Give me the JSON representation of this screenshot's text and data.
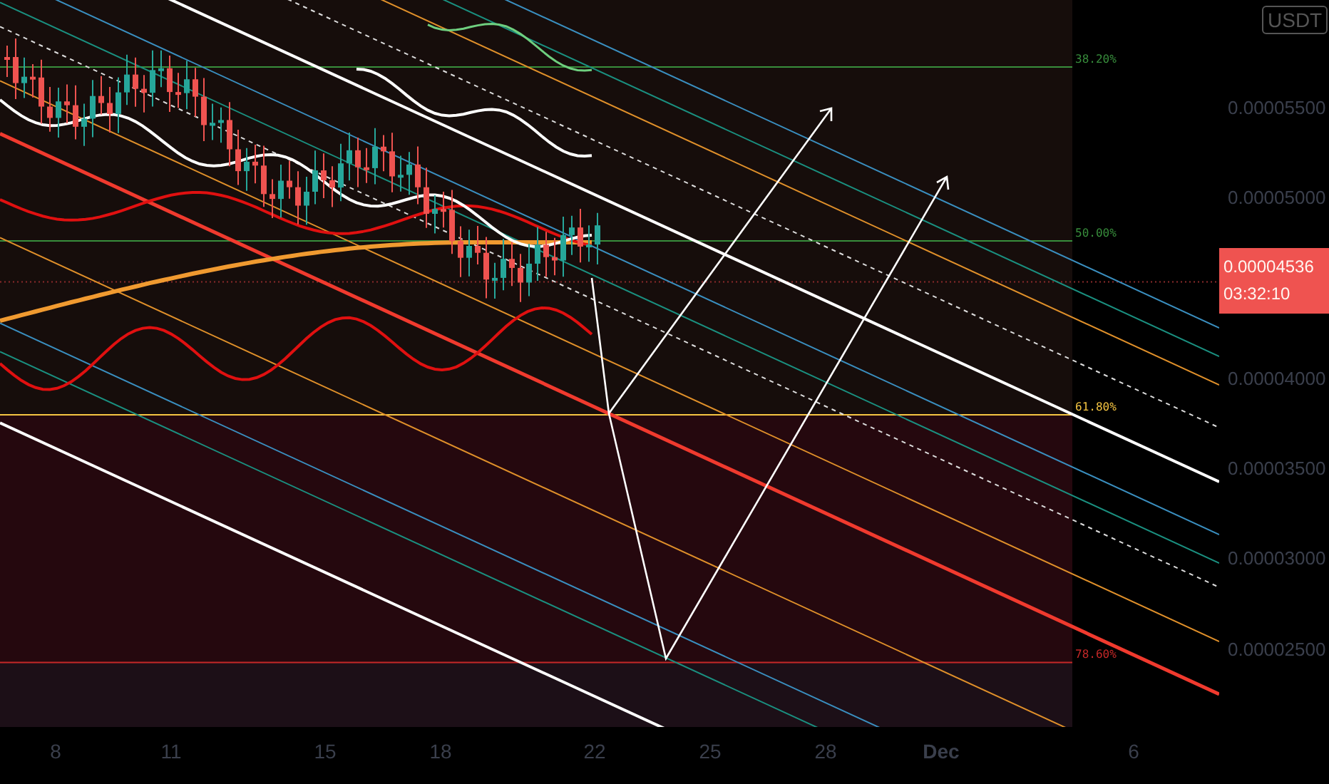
{
  "chart": {
    "fib_levels": [
      {
        "label": "38.20%",
        "color": "#388e3c"
      },
      {
        "label": "50.00%",
        "color": "#388e3c"
      },
      {
        "label": "61.80%",
        "color": "#f5c542"
      },
      {
        "label": "78.60%",
        "color": "#c62828"
      }
    ]
  },
  "price_axis": {
    "currency_button": "USDT",
    "labels": [
      "0.00005500",
      "0.00005000",
      "0.00004000",
      "0.00003500",
      "0.00003000",
      "0.00002500"
    ]
  },
  "last_price": {
    "price": "0.00004536",
    "countdown": "03:32:10"
  },
  "time_axis": [
    {
      "label": "8",
      "kind": "day"
    },
    {
      "label": "11",
      "kind": "day"
    },
    {
      "label": "15",
      "kind": "day"
    },
    {
      "label": "18",
      "kind": "day"
    },
    {
      "label": "22",
      "kind": "day"
    },
    {
      "label": "25",
      "kind": "day"
    },
    {
      "label": "28",
      "kind": "day"
    },
    {
      "label": "Dec",
      "kind": "month"
    },
    {
      "label": "6",
      "kind": "day"
    }
  ]
}
